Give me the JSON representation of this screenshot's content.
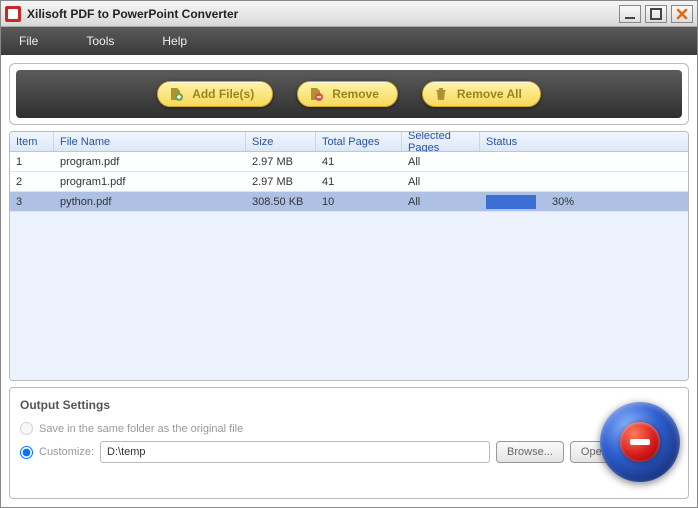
{
  "title": "Xilisoft PDF to PowerPoint Converter",
  "menu": {
    "file": "File",
    "tools": "Tools",
    "help": "Help"
  },
  "toolbar": {
    "add": "Add File(s)",
    "remove": "Remove",
    "remove_all": "Remove All"
  },
  "columns": {
    "item": "Item",
    "file_name": "File Name",
    "size": "Size",
    "total_pages": "Total Pages",
    "selected_pages": "Selected Pages",
    "status": "Status"
  },
  "rows": [
    {
      "item": "1",
      "name": "program.pdf",
      "size": "2.97 MB",
      "pages": "41",
      "selected": "All",
      "status": ""
    },
    {
      "item": "2",
      "name": "program1.pdf",
      "size": "2.97 MB",
      "pages": "41",
      "selected": "All",
      "status": ""
    },
    {
      "item": "3",
      "name": "python.pdf",
      "size": "308.50 KB",
      "pages": "10",
      "selected": "All",
      "status": "30%"
    }
  ],
  "output": {
    "title": "Output Settings",
    "same_folder": "Save in the same folder as the original file",
    "customize": "Customize:",
    "path": "D:\\temp",
    "browse": "Browse...",
    "open": "Open"
  }
}
